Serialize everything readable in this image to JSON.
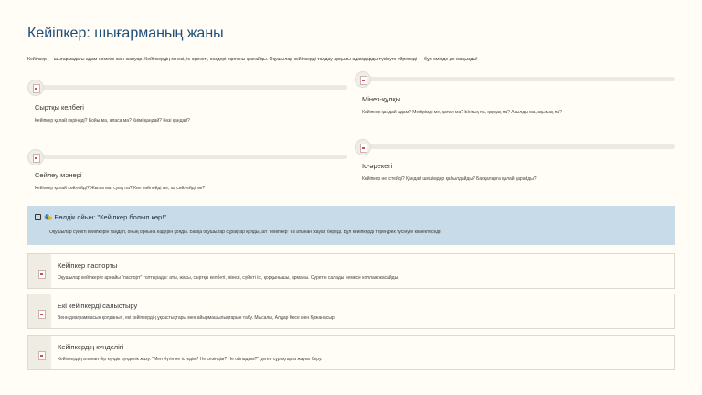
{
  "page": {
    "title": "Кейіпкер: шығарманың жаны",
    "intro": "Кейіпкер — шығармадағы адам немесе жан-жануар. Кейіпкердің мінезі, іс-әрекеті, сөздері оқиғаны қозғайды. Оқушылар кейіпкерді талдау арқылы адамдарды түсінуге үйренеді — бұл өмірде де маңызды!"
  },
  "cards": [
    {
      "heading": "Сыртқы келбеті",
      "body": "Кейіпкер қалай көрінеді? Бойы ма, аласа ма? Киімі қандай? Көзі қандай?"
    },
    {
      "heading": "Мінез-құлқы",
      "body": "Кейіпкер қандай адам? Мейірімді ме, қатал ма? Ынтық па, қорқақ па? Ақылды ма, ақымақ па?"
    },
    {
      "heading": "Сөйлеу мәнері",
      "body": "Кейіпкер қалай сөйлейді? Жылы ма, суық па? Көп сөйлейді ме, аз сөйлейді ме?"
    },
    {
      "heading": "Іс-әрекеті",
      "body": "Кейіпкер не істейді? Қандай шешімдер қабылдайды? Басқаларға қалай қарайды?"
    }
  ],
  "game": {
    "heading": "🎭 Рөлдік ойын: \"Кейіпкер болып көр!\"",
    "body": "Оқушылар сүйікті кейіпкерін таңдап, оның орнына өздерін қояды. Басқа оқушылар сұрақтар қояды, ал \"кейіпкер\" өз атынан жауап береді. Бұл кейіпкерді тереңірек түсінуге көмектеседі!"
  },
  "activities": [
    {
      "heading": "Кейіпкер паспорты",
      "body": "Оқушылар кейіпкерге арнайы \"паспорт\" толтырады: аты, жасы, сыртқы келбеті, мінезі, сүйікті ісі, қорқынышы, арманы. Суретін салады немесе коллаж жасайды."
    },
    {
      "heading": "Екі кейіпкерді салыстыру",
      "body": "Венн диаграммасын қолданып, екі кейіпкердің ұқсастықтары мен айырмашылықтарын табу. Мысалы, Алдар Көсе мен Қожанасыр."
    },
    {
      "heading": "Кейіпкердің күнделігі",
      "body": "Кейіпкердің атынан бір күндік күнделік жазу. \"Мен бүгін не істедім? Не сезіндім? Не ойладым?\" деген сұрақтарға жауап беру."
    }
  ]
}
